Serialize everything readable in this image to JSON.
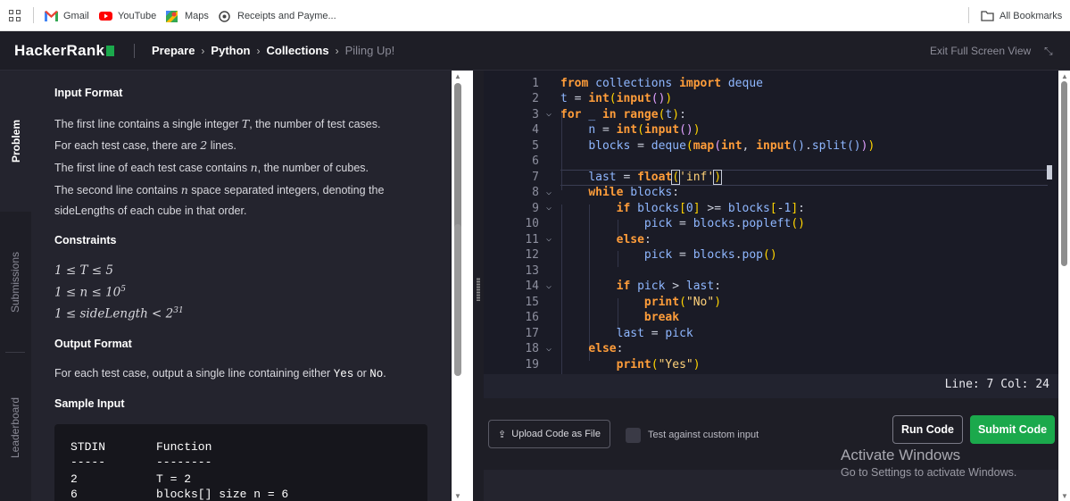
{
  "bookmarks": {
    "items": [
      {
        "label": "Gmail",
        "icon": "gmail-icon"
      },
      {
        "label": "YouTube",
        "icon": "youtube-icon"
      },
      {
        "label": "Maps",
        "icon": "maps-icon"
      },
      {
        "label": "Receipts and Payme...",
        "icon": "receipts-icon"
      }
    ],
    "all_bookmarks": "All Bookmarks"
  },
  "header": {
    "logo": "HackerRank",
    "breadcrumbs": [
      "Prepare",
      "Python",
      "Collections",
      "Piling Up!"
    ],
    "exit_fullscreen": "Exit Full Screen View"
  },
  "side_tabs": [
    "Problem",
    "Submissions",
    "Leaderboard"
  ],
  "problem": {
    "input_format_heading": "Input Format",
    "input_lines": [
      [
        "The first line contains a single integer ",
        "T",
        ", the number of test cases."
      ],
      [
        "For each test case, there are ",
        "2",
        " lines."
      ],
      [
        "The first line of each test case contains ",
        "n",
        ", the number of cubes."
      ],
      [
        "The second line contains ",
        "n",
        " space separated integers, denoting the"
      ],
      [
        "sideLengths of each cube in that order.",
        "",
        ""
      ]
    ],
    "constraints_heading": "Constraints",
    "constraints": [
      {
        "text": "1 ≤ T ≤ 5",
        "sup": ""
      },
      {
        "text": "1 ≤ n ≤ 10",
        "sup": "5"
      },
      {
        "text": "1 ≤ sideLength < 2",
        "sup": "31"
      }
    ],
    "output_format_heading": "Output Format",
    "output_text_pre": "For each test case, output a single line containing either ",
    "output_yes": "Yes",
    "output_or": " or ",
    "output_no": "No",
    "output_end": ".",
    "sample_input_heading": "Sample Input",
    "sample": {
      "col1_header": "STDIN",
      "col2_header": "Function",
      "col1_rule": "-----",
      "col2_rule": "--------",
      "rows": [
        [
          "2",
          "T = 2"
        ],
        [
          "6",
          "blocks[] size n = 6"
        ]
      ]
    }
  },
  "editor": {
    "line_numbers": [
      "1",
      "2",
      "3",
      "4",
      "5",
      "6",
      "7",
      "8",
      "9",
      "10",
      "11",
      "12",
      "13",
      "14",
      "15",
      "16",
      "17",
      "18",
      "19"
    ],
    "status": "Line: 7 Col: 24"
  },
  "actions": {
    "upload": "Upload Code as File",
    "custom_input": "Test against custom input",
    "run": "Run Code",
    "submit": "Submit Code"
  },
  "watermark": {
    "title": "Activate Windows",
    "subtitle": "Go to Settings to activate Windows."
  },
  "colors": {
    "accent_green": "#1ba94c",
    "keyword_orange": "#ff9d3a",
    "identifier_blue": "#8fb7ff"
  }
}
